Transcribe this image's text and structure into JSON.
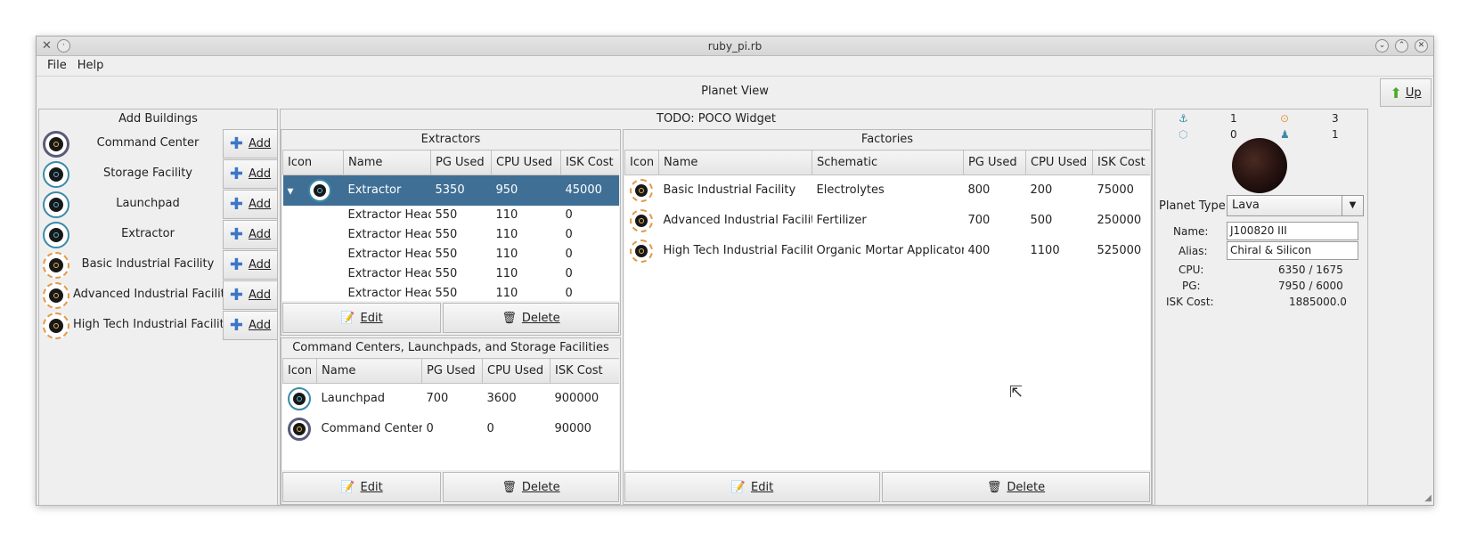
{
  "window": {
    "title": "ruby_pi.rb"
  },
  "menu": {
    "file": "File",
    "help": "Help"
  },
  "view": {
    "title": "Planet View",
    "up_label": "Up"
  },
  "add_buildings": {
    "title": "Add Buildings",
    "add_label": "Add",
    "items": [
      {
        "label": "Command Center"
      },
      {
        "label": "Storage Facility"
      },
      {
        "label": "Launchpad"
      },
      {
        "label": "Extractor"
      },
      {
        "label": "Basic Industrial Facility"
      },
      {
        "label": "Advanced Industrial Facility"
      },
      {
        "label": "High Tech Industrial Facility"
      }
    ]
  },
  "todo": {
    "title": "TODO: POCO Widget"
  },
  "extractors": {
    "title": "Extractors",
    "headers": [
      "Icon",
      "Name",
      "PG Used",
      "CPU Used",
      "ISK Cost"
    ],
    "rows": [
      {
        "name": "Extractor",
        "pg": "5350",
        "cpu": "950",
        "isk": "45000"
      },
      {
        "name": "Extractor Head",
        "pg": "550",
        "cpu": "110",
        "isk": "0"
      },
      {
        "name": "Extractor Head",
        "pg": "550",
        "cpu": "110",
        "isk": "0"
      },
      {
        "name": "Extractor Head",
        "pg": "550",
        "cpu": "110",
        "isk": "0"
      },
      {
        "name": "Extractor Head",
        "pg": "550",
        "cpu": "110",
        "isk": "0"
      },
      {
        "name": "Extractor Head",
        "pg": "550",
        "cpu": "110",
        "isk": "0"
      }
    ],
    "edit_label": "Edit",
    "delete_label": "Delete"
  },
  "ccs": {
    "title": "Command Centers, Launchpads, and Storage Facilities",
    "headers": [
      "Icon",
      "Name",
      "PG Used",
      "CPU Used",
      "ISK Cost"
    ],
    "rows": [
      {
        "name": "Launchpad",
        "pg": "700",
        "cpu": "3600",
        "isk": "900000"
      },
      {
        "name": "Command Center",
        "pg": "0",
        "cpu": "0",
        "isk": "90000"
      }
    ],
    "edit_label": "Edit",
    "delete_label": "Delete"
  },
  "factories": {
    "title": "Factories",
    "headers": [
      "Icon",
      "Name",
      "Schematic",
      "PG Used",
      "CPU Used",
      "ISK Cost"
    ],
    "rows": [
      {
        "name": "Basic Industrial Facility",
        "schematic": "Electrolytes",
        "pg": "800",
        "cpu": "200",
        "isk": "75000"
      },
      {
        "name": "Advanced Industrial Facility",
        "schematic": "Fertilizer",
        "pg": "700",
        "cpu": "500",
        "isk": "250000"
      },
      {
        "name": "High Tech Industrial Facility",
        "schematic": "Organic Mortar Applicators",
        "pg": "400",
        "cpu": "1100",
        "isk": "525000"
      }
    ],
    "edit_label": "Edit",
    "delete_label": "Delete"
  },
  "summary": {
    "counts": {
      "launchpad": "1",
      "factory": "3",
      "storage": "0",
      "extractor": "1"
    },
    "planet_type_label": "Planet Type:",
    "planet_type": "Lava",
    "name_label": "Name:",
    "name_value": "J100820 III",
    "alias_label": "Alias:",
    "alias_value": "Chiral & Silicon",
    "cpu_label": "CPU:",
    "cpu_value": "6350 / 1675",
    "pg_label": "PG:",
    "pg_value": "7950 / 6000",
    "isk_label": "ISK Cost:",
    "isk_value": "1885000.0"
  }
}
